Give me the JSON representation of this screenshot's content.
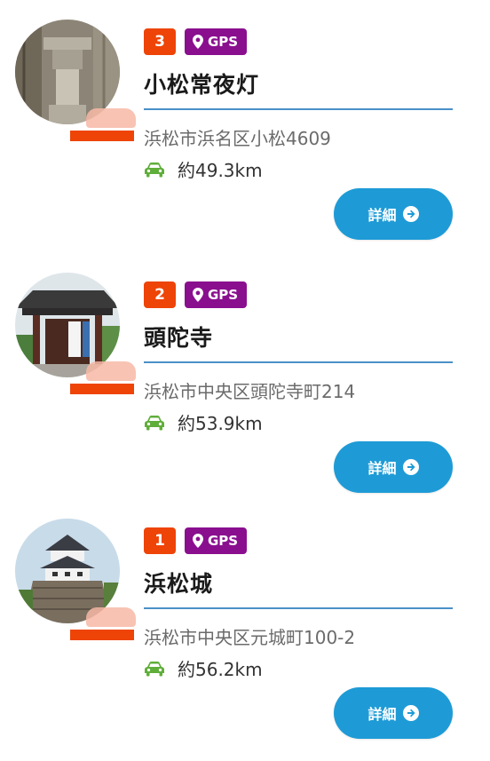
{
  "items": [
    {
      "rank": "3",
      "gps_label": "GPS",
      "title": "小松常夜灯",
      "address": "浜松市浜名区小松4609",
      "distance": "約49.3km",
      "detail_label": "詳細",
      "icons": {
        "pin": "map-pin-icon",
        "car": "car-icon",
        "arrow": "arrow-right-circle-icon"
      }
    },
    {
      "rank": "2",
      "gps_label": "GPS",
      "title": "頭陀寺",
      "address": "浜松市中央区頭陀寺町214",
      "distance": "約53.9km",
      "detail_label": "詳細",
      "icons": {
        "pin": "map-pin-icon",
        "car": "car-icon",
        "arrow": "arrow-right-circle-icon"
      }
    },
    {
      "rank": "1",
      "gps_label": "GPS",
      "title": "浜松城",
      "address": "浜松市中央区元城町100-2",
      "distance": "約56.2km",
      "detail_label": "詳細",
      "icons": {
        "pin": "map-pin-icon",
        "car": "car-icon",
        "arrow": "arrow-right-circle-icon"
      }
    }
  ],
  "colors": {
    "rank_badge": "#ee4407",
    "gps_badge": "#8a0f8f",
    "divider": "#4a90c8",
    "detail_button": "#1e9bd6",
    "car_icon": "#5fae3a"
  }
}
